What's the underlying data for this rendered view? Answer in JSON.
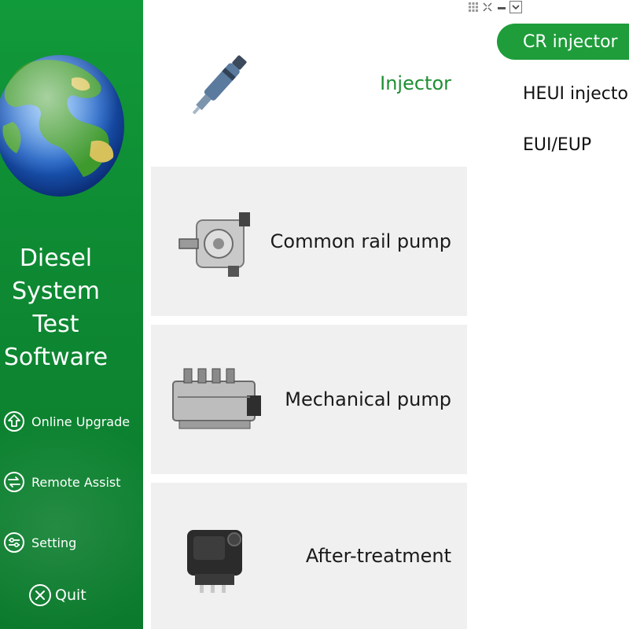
{
  "sidebar": {
    "title_lines": [
      "Diesel",
      "System",
      "Test",
      "Software"
    ],
    "items": [
      {
        "label": "Online Upgrade",
        "icon": "upgrade-icon"
      },
      {
        "label": "Remote Assist",
        "icon": "remote-assist-icon"
      },
      {
        "label": "Setting",
        "icon": "settings-icon"
      }
    ],
    "quit_label": "Quit",
    "quit_icon": "close-circle-icon",
    "accent_color": "#119a3a"
  },
  "categories": [
    {
      "label": "Injector",
      "icon": "injector-image",
      "selected": true
    },
    {
      "label": "Common rail pump",
      "icon": "common-rail-pump-image",
      "selected": false
    },
    {
      "label": "Mechanical pump",
      "icon": "mechanical-pump-image",
      "selected": false
    },
    {
      "label": "After-treatment",
      "icon": "after-treatment-image",
      "selected": false
    }
  ],
  "submenu": {
    "items": [
      {
        "label": "CR injector",
        "selected": true
      },
      {
        "label": "HEUI injector",
        "selected": false
      },
      {
        "label": "EUI/EUP",
        "selected": false
      }
    ],
    "selected_color": "#1e9d3a"
  },
  "window_controls": [
    "grid-icon",
    "restore-icon",
    "minimize-icon",
    "dropdown-icon"
  ]
}
